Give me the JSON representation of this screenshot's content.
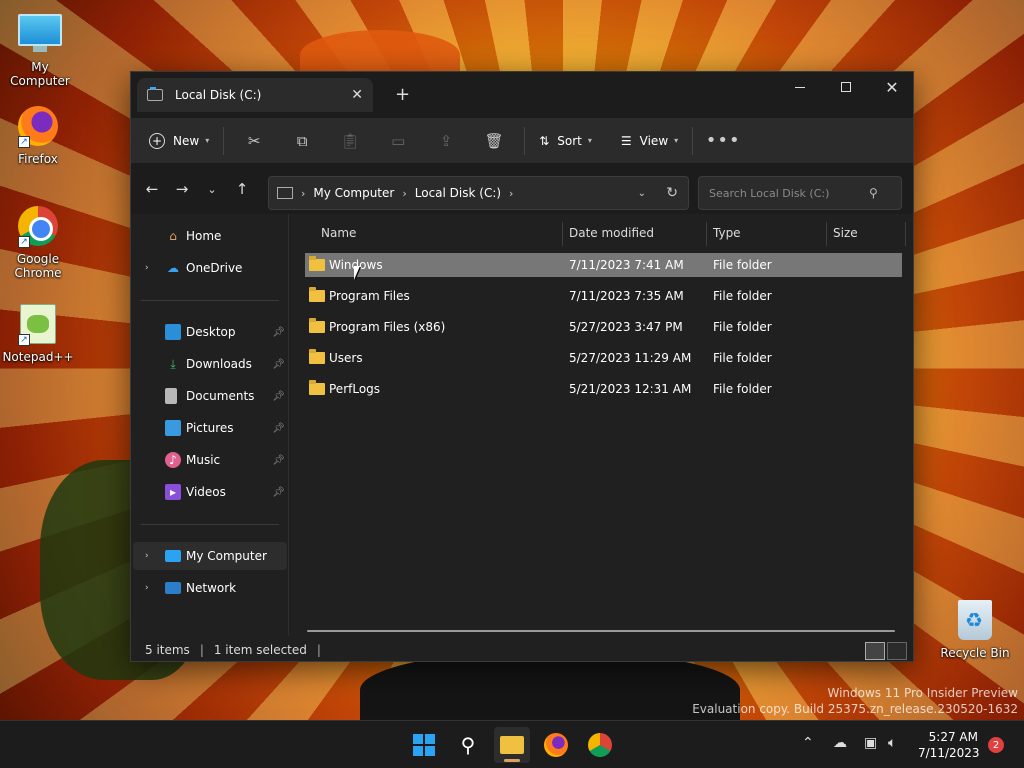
{
  "desktop": {
    "icons": [
      {
        "label": "My Computer"
      },
      {
        "label": "Firefox"
      },
      {
        "label": "Google Chrome"
      },
      {
        "label": "Notepad++"
      },
      {
        "label": "Recycle Bin"
      }
    ],
    "watermark": [
      "Windows 11 Pro Insider Preview",
      "Evaluation copy. Build 25375.zn_release.230520-1632"
    ]
  },
  "window": {
    "tab_title": "Local Disk (C:)",
    "toolbar": {
      "new_label": "New",
      "sort_label": "Sort",
      "view_label": "View"
    },
    "address": {
      "crumbs": [
        "My Computer",
        "Local Disk (C:)"
      ]
    },
    "search": {
      "placeholder": "Search Local Disk (C:)"
    },
    "sidebar": {
      "items": [
        {
          "label": "Home"
        },
        {
          "label": "OneDrive"
        },
        {
          "label": "Desktop"
        },
        {
          "label": "Downloads"
        },
        {
          "label": "Documents"
        },
        {
          "label": "Pictures"
        },
        {
          "label": "Music"
        },
        {
          "label": "Videos"
        },
        {
          "label": "My Computer"
        },
        {
          "label": "Network"
        }
      ]
    },
    "columns": {
      "name": "Name",
      "date": "Date modified",
      "type": "Type",
      "size": "Size"
    },
    "rows": [
      {
        "name": "Windows",
        "date": "7/11/2023 7:41 AM",
        "type": "File folder"
      },
      {
        "name": "Program Files",
        "date": "7/11/2023 7:35 AM",
        "type": "File folder"
      },
      {
        "name": "Program Files (x86)",
        "date": "5/27/2023 3:47 PM",
        "type": "File folder"
      },
      {
        "name": "Users",
        "date": "5/27/2023 11:29 AM",
        "type": "File folder"
      },
      {
        "name": "PerfLogs",
        "date": "5/21/2023 12:31 AM",
        "type": "File folder"
      }
    ],
    "status": {
      "count": "5 items",
      "selected": "1 item selected"
    }
  },
  "taskbar": {
    "time": "5:27 AM",
    "date": "7/11/2023",
    "notifications": "2"
  },
  "colors": {
    "accent": "#2aa3f2",
    "folder": "#f0c040",
    "selection": "#777777"
  }
}
